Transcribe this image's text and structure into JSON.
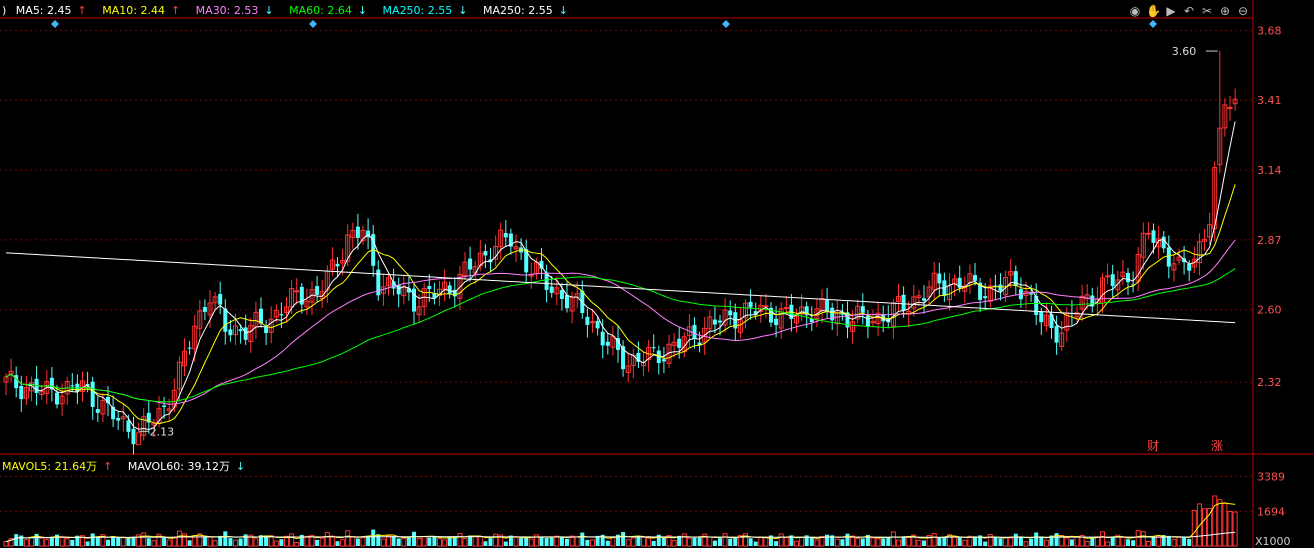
{
  "legend_main": [
    {
      "label": "MA5: 2.45",
      "arrow": "↑",
      "color": "#ffffff"
    },
    {
      "label": "MA10: 2.44",
      "arrow": "↑",
      "color": "#ffff00"
    },
    {
      "label": "MA30: 2.53",
      "arrow": "↓",
      "color": "#ff80ff"
    },
    {
      "label": "MA60: 2.64",
      "arrow": "↓",
      "color": "#00ff00"
    },
    {
      "label": "MA250: 2.55",
      "arrow": "↓",
      "color": "#00ffff"
    },
    {
      "label": "MA250: 2.55",
      "arrow": "↓",
      "color": "#ffffff"
    }
  ],
  "legend_vol": [
    {
      "label": "MAVOL5: 21.64万",
      "arrow": "↑",
      "color": "#ffff00"
    },
    {
      "label": "MAVOL60: 39.12万",
      "arrow": "↓",
      "color": "#ffffff"
    }
  ],
  "toolbar_icons": [
    "eye-icon",
    "hand-icon",
    "play-icon",
    "undo-icon",
    "scissors-icon",
    "zoom-in-icon",
    "zoom-out-icon"
  ],
  "markers": {
    "high_label": "3.60",
    "low_label": "2.13",
    "event_cai": "财",
    "event_zhang": "涨"
  },
  "colors": {
    "up": "#ff3232",
    "down": "#54ffff",
    "grid": "#7a0000",
    "axis": "#c00000",
    "axis_text": "#ff5050"
  },
  "chart_data": [
    {
      "type": "candlestick",
      "title": "",
      "ylim": [
        2.05,
        3.72
      ],
      "y_ticks": [
        "3.68",
        "3.41",
        "3.14",
        "2.87",
        "2.60",
        "2.32"
      ],
      "y_tick_values": [
        3.68,
        3.41,
        3.14,
        2.87,
        2.6,
        2.32
      ],
      "grid": true,
      "close_anchors": [
        [
          0,
          2.32
        ],
        [
          8,
          2.28
        ],
        [
          15,
          2.3
        ],
        [
          22,
          2.17
        ],
        [
          26,
          2.12
        ],
        [
          31,
          2.22
        ],
        [
          34,
          2.35
        ],
        [
          37,
          2.54
        ],
        [
          40,
          2.66
        ],
        [
          43,
          2.53
        ],
        [
          47,
          2.52
        ],
        [
          51,
          2.55
        ],
        [
          55,
          2.62
        ],
        [
          58,
          2.66
        ],
        [
          61,
          2.66
        ],
        [
          64,
          2.75
        ],
        [
          67,
          2.88
        ],
        [
          70,
          2.9
        ],
        [
          73,
          2.71
        ],
        [
          76,
          2.68
        ],
        [
          80,
          2.64
        ],
        [
          84,
          2.66
        ],
        [
          88,
          2.7
        ],
        [
          92,
          2.78
        ],
        [
          96,
          2.85
        ],
        [
          99,
          2.87
        ],
        [
          102,
          2.78
        ],
        [
          106,
          2.7
        ],
        [
          110,
          2.64
        ],
        [
          114,
          2.58
        ],
        [
          118,
          2.46
        ],
        [
          122,
          2.4
        ],
        [
          127,
          2.42
        ],
        [
          133,
          2.48
        ],
        [
          138,
          2.54
        ],
        [
          143,
          2.58
        ],
        [
          148,
          2.6
        ],
        [
          153,
          2.57
        ],
        [
          158,
          2.6
        ],
        [
          163,
          2.58
        ],
        [
          168,
          2.56
        ],
        [
          173,
          2.58
        ],
        [
          178,
          2.64
        ],
        [
          183,
          2.7
        ],
        [
          188,
          2.7
        ],
        [
          193,
          2.67
        ],
        [
          198,
          2.72
        ],
        [
          201,
          2.63
        ],
        [
          203,
          2.55
        ],
        [
          207,
          2.52
        ],
        [
          211,
          2.63
        ],
        [
          216,
          2.7
        ],
        [
          221,
          2.74
        ],
        [
          224,
          2.9
        ],
        [
          227,
          2.84
        ],
        [
          230,
          2.75
        ],
        [
          233,
          2.8
        ],
        [
          236,
          2.95
        ],
        [
          239,
          3.42
        ],
        [
          241,
          3.4
        ]
      ],
      "volume_ylim": [
        0,
        3900
      ],
      "volume_ticks": [
        "3389",
        "1694"
      ],
      "volume_tick_values": [
        3389,
        1694
      ],
      "volume_unit": "X1000",
      "ma_series": [
        {
          "name": "MA5",
          "color": "#ffffff",
          "period": 5
        },
        {
          "name": "MA10",
          "color": "#ffff00",
          "period": 10
        },
        {
          "name": "MA30",
          "color": "#ff80ff",
          "period": 30
        },
        {
          "name": "MA60",
          "color": "#00ff00",
          "period": 60
        },
        {
          "name": "MA250",
          "color": "#ffffff",
          "period": 250
        }
      ]
    }
  ]
}
